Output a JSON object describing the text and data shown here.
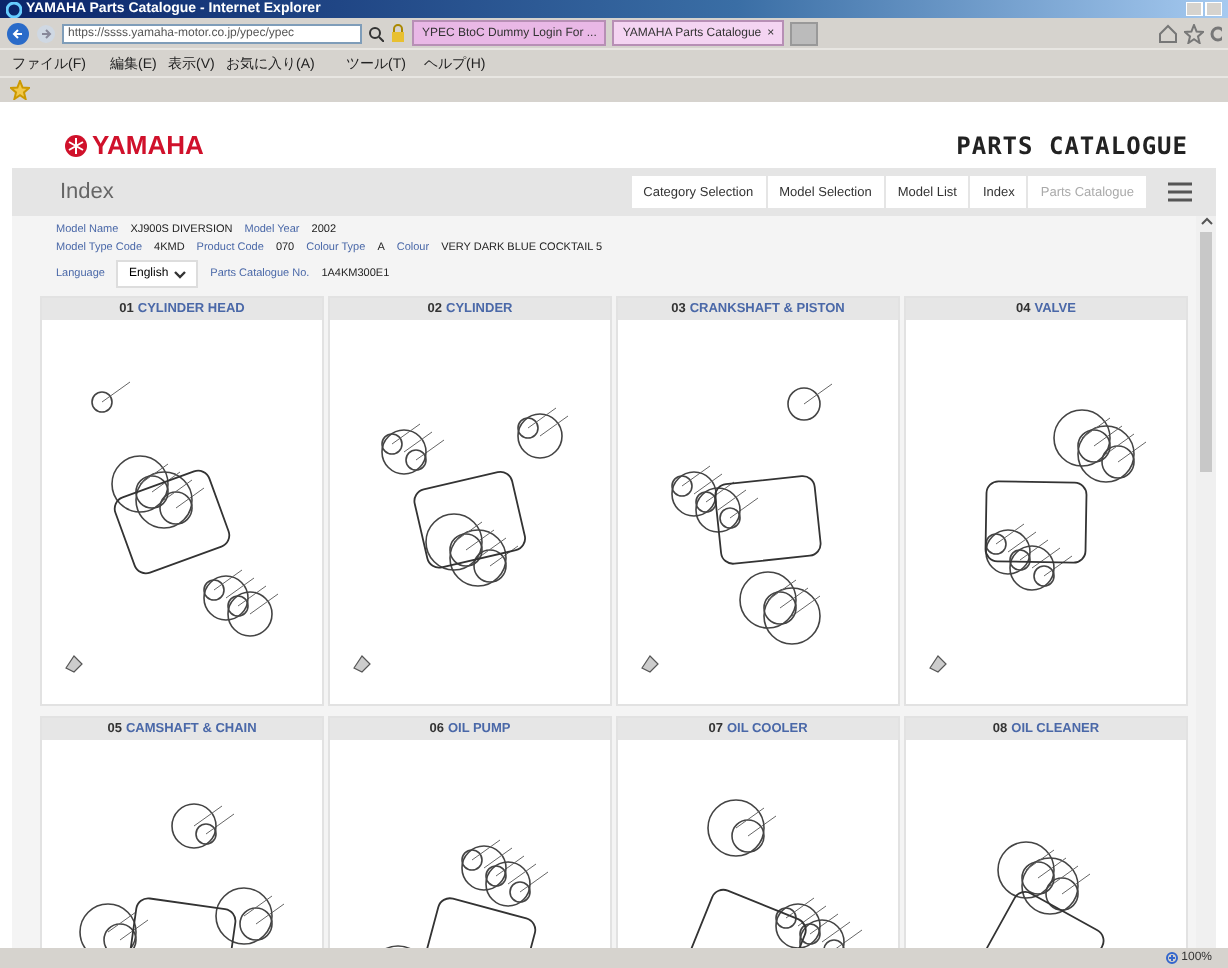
{
  "window": {
    "title": "YAMAHA Parts Catalogue - Internet Explorer"
  },
  "address_bar": {
    "url": "https://ssss.yamaha-motor.co.jp/ypec/ypec"
  },
  "tabs": [
    {
      "label": "YPEC BtoC Dummy Login For ...",
      "selected": false
    },
    {
      "label": "YAMAHA Parts Catalogue",
      "selected": true,
      "close": "×"
    }
  ],
  "menu": [
    "ファイル(F)",
    "編集(E)",
    "表示(V)",
    "お気に入り(A)",
    "ツール(T)",
    "ヘルプ(H)"
  ],
  "header": {
    "logo": "YAMAHA",
    "title": "PARTS CATALOGUE"
  },
  "page_title": "Index",
  "nav": [
    {
      "label": "Category Selection",
      "disabled": false
    },
    {
      "label": "Model Selection",
      "disabled": false
    },
    {
      "label": "Model List",
      "disabled": false
    },
    {
      "label": "Index",
      "disabled": false
    },
    {
      "label": "Parts Catalogue",
      "disabled": true
    }
  ],
  "info_rows": [
    [
      {
        "label": "Model Name",
        "value": "XJ900S DIVERSION"
      },
      {
        "label": "Model Year",
        "value": "2002"
      }
    ],
    [
      {
        "label": "Model Type Code",
        "value": "4KMD"
      },
      {
        "label": "Product Code",
        "value": "070"
      },
      {
        "label": "Colour Type",
        "value": "A"
      },
      {
        "label": "Colour",
        "value": "VERY DARK BLUE COCKTAIL 5"
      }
    ]
  ],
  "language": {
    "label": "Language",
    "value": "English"
  },
  "catalogue_no": {
    "label": "Parts Catalogue No.",
    "value": "1A4KM300E1"
  },
  "cards": [
    {
      "number": "01",
      "name": "CYLINDER HEAD"
    },
    {
      "number": "02",
      "name": "CYLINDER"
    },
    {
      "number": "03",
      "name": "CRANKSHAFT & PISTON"
    },
    {
      "number": "04",
      "name": "VALVE"
    },
    {
      "number": "05",
      "name": "CAMSHAFT & CHAIN"
    },
    {
      "number": "06",
      "name": "OIL PUMP"
    },
    {
      "number": "07",
      "name": "OIL COOLER"
    },
    {
      "number": "08",
      "name": "OIL CLEANER"
    }
  ],
  "status_bar": {
    "zoom": "100%"
  }
}
